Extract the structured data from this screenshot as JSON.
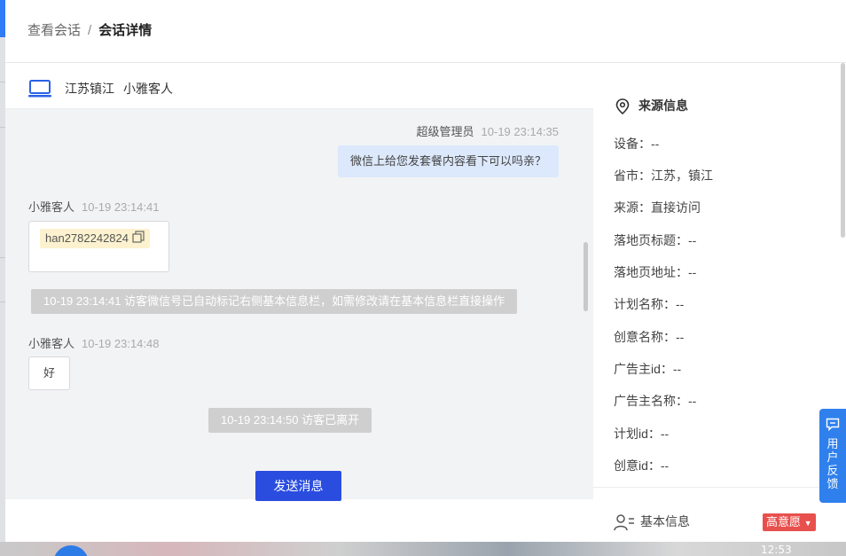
{
  "breadcrumb": {
    "parent": "查看会话",
    "separator": "/",
    "current": "会话详情"
  },
  "chat_header": {
    "location": "江苏镇江",
    "visitor": "小雅客人"
  },
  "messages": {
    "admin": {
      "name": "超级管理员",
      "time": "10-19 23:14:35",
      "text": "微信上给您发套餐内容看下可以吗亲？"
    },
    "visitor1": {
      "name": "小雅客人",
      "time": "10-19 23:14:41",
      "tag": "han2782242824"
    },
    "system1": "10-19 23:14:41 访客微信号已自动标记右侧基本信息栏，如需修改请在基本信息栏直接操作",
    "visitor2": {
      "name": "小雅客人",
      "time": "10-19 23:14:48",
      "text": "好"
    },
    "system2": "10-19 23:14:50 访客已离开"
  },
  "send_button": "发送消息",
  "source": {
    "title": "来源信息",
    "rows": [
      "设备：--",
      "省市：江苏，镇江",
      "来源：直接访问",
      "落地页标题：--",
      "落地页地址：--",
      "计划名称：--",
      "创意名称：--",
      "广告主id：--",
      "广告主名称：--",
      "计划id：--",
      "创意id：--"
    ]
  },
  "basic_info": {
    "title": "基本信息",
    "intent": "高意愿",
    "intent_color": "#e8504d"
  },
  "feedback": "用户反馈",
  "taskbar_time": "12:53",
  "colors": {
    "primary": "#2a4de0",
    "accent": "#2f80ed"
  }
}
